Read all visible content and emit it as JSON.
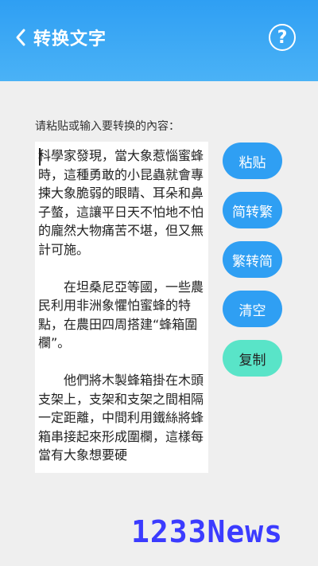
{
  "header": {
    "title": "转换文字",
    "back_icon": "chevron-left-icon",
    "help_label": "?",
    "help_icon": "help-circle-icon",
    "background_color": "#2f9ff3"
  },
  "prompt": "请粘贴或输入要转换的內容：",
  "input": {
    "paragraphs": [
      "科學家發現，當大象惹惱蜜蜂時，這種勇敢的小昆蟲就會專揀大象脆弱的眼睛、耳朵和鼻子螫，這讓平日天不怕地不怕的龐然大物痛苦不堪，但又無計可施。",
      "　　在坦桑尼亞等國，一些農民利用非洲象懼怕蜜蜂的特點，在農田四周搭建“蜂箱圍欄”。",
      "　　他們將木製蜂箱掛在木頭支架上，支架和支架之間相隔一定距離，中間利用鐵絲將蜂箱串接起來形成圍欄，這樣每當有大象想要硬"
    ]
  },
  "buttons": {
    "paste": "粘贴",
    "to_traditional": "简转繁",
    "to_simplified": "繁转简",
    "clear": "清空",
    "copy": "复制",
    "primary_color": "#2f9ff3",
    "copy_color": "#59e4c8"
  },
  "watermark": "1233News"
}
